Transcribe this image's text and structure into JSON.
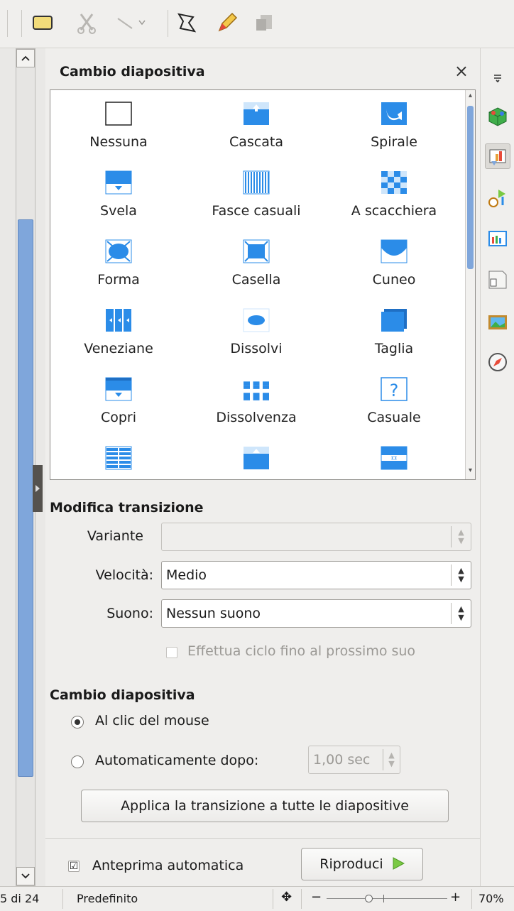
{
  "panel": {
    "title": "Cambio diapositiva",
    "close_glyph": "×"
  },
  "transitions": [
    {
      "label": "Nessuna",
      "icon": "none-transition-icon"
    },
    {
      "label": "Cascata",
      "icon": "cascade-transition-icon"
    },
    {
      "label": "Spirale",
      "icon": "spiral-transition-icon"
    },
    {
      "label": "Svela",
      "icon": "uncover-transition-icon"
    },
    {
      "label": "Fasce casuali",
      "icon": "random-bars-transition-icon"
    },
    {
      "label": "A scacchiera",
      "icon": "checkerboard-transition-icon"
    },
    {
      "label": "Forma",
      "icon": "shape-transition-icon"
    },
    {
      "label": "Casella",
      "icon": "box-transition-icon"
    },
    {
      "label": "Cuneo",
      "icon": "wedge-transition-icon"
    },
    {
      "label": "Veneziane",
      "icon": "venetian-transition-icon"
    },
    {
      "label": "Dissolvi",
      "icon": "fade-transition-icon"
    },
    {
      "label": "Taglia",
      "icon": "cut-transition-icon"
    },
    {
      "label": "Copri",
      "icon": "cover-transition-icon"
    },
    {
      "label": "Dissolvenza",
      "icon": "dissolve-transition-icon"
    },
    {
      "label": "Casuale",
      "icon": "random-transition-icon"
    },
    {
      "label": "",
      "icon": "bars-transition-icon"
    },
    {
      "label": "",
      "icon": "push-transition-icon"
    },
    {
      "label": "",
      "icon": "split-transition-icon"
    }
  ],
  "modify": {
    "title": "Modifica transizione",
    "variant_label": "Variante",
    "variant_value": "",
    "speed_label": "Velocità:",
    "speed_value": "Medio",
    "sound_label": "Suono:",
    "sound_value": "Nessun suono",
    "loop_label": "Effettua ciclo fino al prossimo suo"
  },
  "advance": {
    "title": "Cambio diapositiva",
    "on_click_label": "Al clic del mouse",
    "auto_label": "Automaticamente dopo:",
    "auto_value": "1,00 sec",
    "apply_all_label": "Applica la transizione a tutte le diapositive"
  },
  "footer": {
    "auto_preview_label": "Anteprima automatica",
    "auto_preview_checked": "☑",
    "play_label": "Riproduci"
  },
  "status": {
    "slide_count": "5 di 24",
    "layout_name": "Predefinito",
    "zoom": "70%"
  },
  "colors": {
    "accent_blue": "#2b8ce8",
    "thumb_blue": "#7fa6db",
    "play_green": "#7ac943"
  }
}
